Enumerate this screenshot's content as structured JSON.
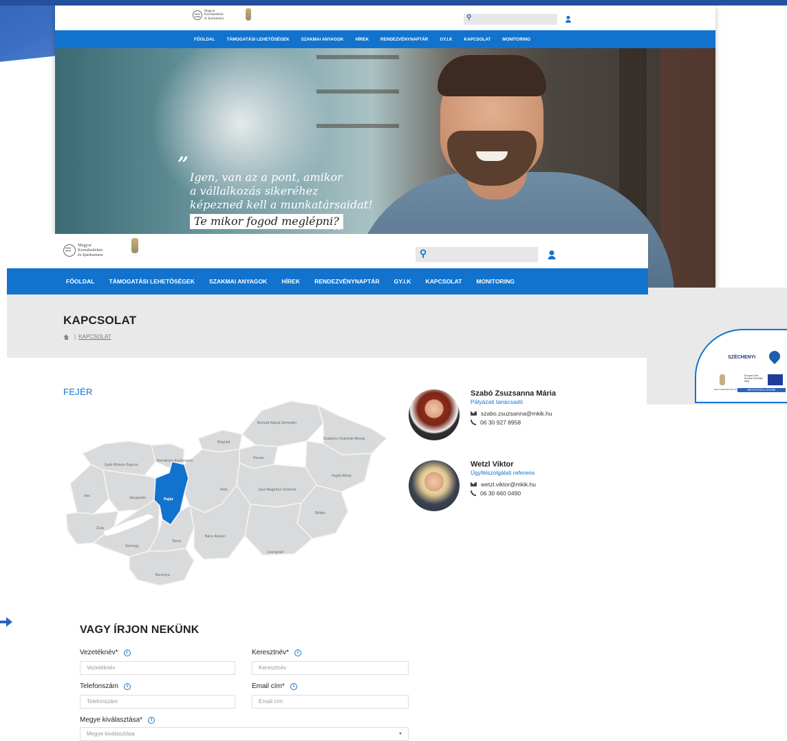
{
  "nav": {
    "items": [
      "FŐOLDAL",
      "TÁMOGATÁSI LEHETŐSÉGEK",
      "SZAKMAI ANYAGOK",
      "HÍREK",
      "RENDEZVÉNYNAPTÁR",
      "GY.I.K",
      "KAPCSOLAT",
      "MONITORING"
    ]
  },
  "logo": {
    "line1": "Magyar",
    "line2": "Kereskedelmi",
    "line3": "és Iparkamara"
  },
  "hero": {
    "quote_lines": [
      "Igen, van az a pont, amikor",
      "a vállalkozás sikeréhez",
      "képezned kell a munkatársaidat!"
    ],
    "cta": "Te mikor fogod meglépni?",
    "quote_mark": "”"
  },
  "page": {
    "title": "KAPCSOLAT",
    "breadcrumb_sep": "|",
    "breadcrumb_link": "KAPCSOLAT"
  },
  "region": "FEJÉR",
  "map": {
    "selected": "Fejér",
    "selected_color": "#1173cd",
    "counties": [
      "Győr-Moson-Sopron",
      "Komárom-Esztergom",
      "Nógrád",
      "Borsod-Abaúj-Zemplén",
      "Szabolcs-Szatmár-Bereg",
      "Heves",
      "Hajdú-Bihar",
      "Vas",
      "Veszprém",
      "Fejér",
      "Pest",
      "Jász-Nagykun-Szolnok",
      "Zala",
      "Somogy",
      "Tolna",
      "Bács Kiskun",
      "Békés",
      "Csongrád",
      "Baranya"
    ]
  },
  "contacts": [
    {
      "name": "Szabó Zsuzsanna Mária",
      "role": "Pályázati tanácsadó",
      "email": "szabo.zsuzsanna@mkik.hu",
      "phone": "06 30 927 8958"
    },
    {
      "name": "Wetzl Viktor",
      "role": "Ügyfélszolgálati referens",
      "email": "wetzl.viktor@mkik.hu",
      "phone": "06 30 660 0490"
    }
  ],
  "badge": {
    "title": "SZÉCHENYI",
    "bar": "BEFEKTETÉS A JÖVŐBE"
  },
  "form": {
    "title": "VAGY ÍRJON NEKÜNK",
    "info_glyph": "i",
    "fields": {
      "lastname": {
        "label": "Vezetéknév*",
        "placeholder": "Vezetéknév"
      },
      "firstname": {
        "label": "Keresztnév*",
        "placeholder": "Keresztnév"
      },
      "phone": {
        "label": "Telefonszám",
        "placeholder": "Telefonszám"
      },
      "email": {
        "label": "Email cím*",
        "placeholder": "Email cím"
      },
      "county": {
        "label": "Megye kiválasztása*",
        "placeholder": "Megye kiválasztása",
        "caret": "▼"
      }
    }
  }
}
